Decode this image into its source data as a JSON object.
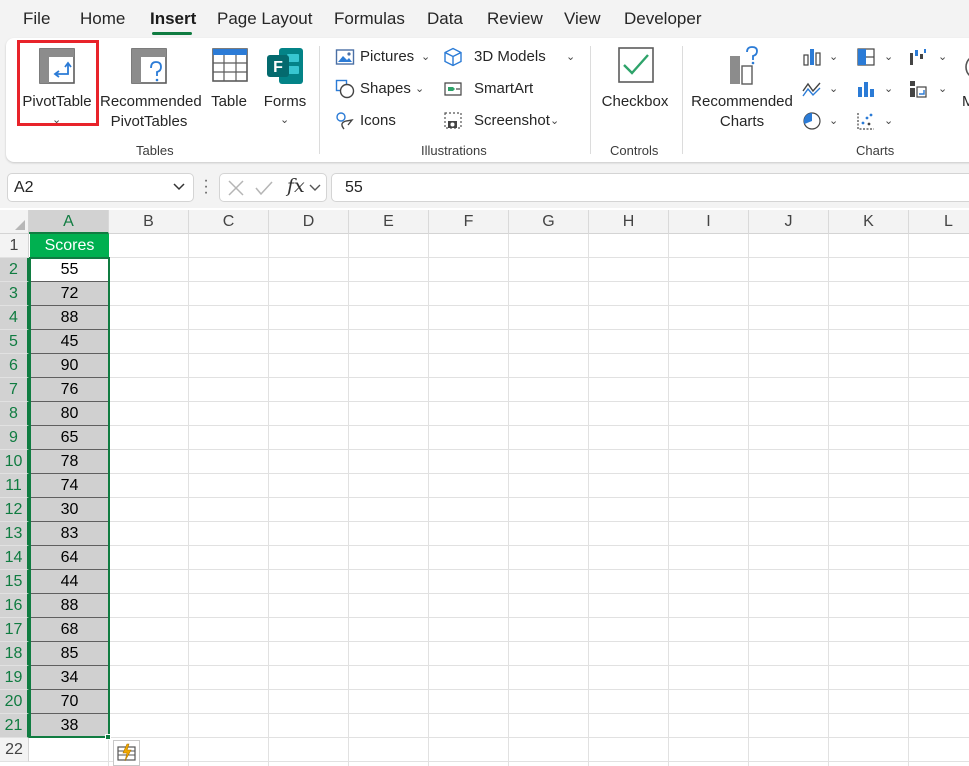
{
  "menu": {
    "tabs": [
      "File",
      "Home",
      "Insert",
      "Page Layout",
      "Formulas",
      "Data",
      "Review",
      "View",
      "Developer"
    ],
    "active_tab": "Insert"
  },
  "ribbon": {
    "tables": {
      "pivottable": "PivotTable",
      "recommended_pivottables_line1": "Recommended",
      "recommended_pivottables_line2": "PivotTables",
      "table": "Table",
      "forms": "Forms",
      "group_label": "Tables"
    },
    "illustrations": {
      "pictures": "Pictures",
      "shapes": "Shapes",
      "icons": "Icons",
      "models_3d": "3D Models",
      "smartart": "SmartArt",
      "screenshot": "Screenshot",
      "group_label": "Illustrations"
    },
    "controls": {
      "checkbox": "Checkbox",
      "group_label": "Controls"
    },
    "charts": {
      "recommended_charts_line1": "Recommended",
      "recommended_charts_line2": "Charts",
      "group_label": "Charts"
    },
    "overflow_label": "M"
  },
  "formula_bar": {
    "name_box": "A2",
    "fx_label": "fx",
    "formula_value": "55"
  },
  "sheet": {
    "columns": [
      "A",
      "B",
      "C",
      "D",
      "E",
      "F",
      "G",
      "H",
      "I",
      "J",
      "K",
      "L"
    ],
    "rows": [
      "1",
      "2",
      "3",
      "4",
      "5",
      "6",
      "7",
      "8",
      "9",
      "10",
      "11",
      "12",
      "13",
      "14",
      "15",
      "16",
      "17",
      "18",
      "19",
      "20",
      "21",
      "22"
    ],
    "header": "Scores",
    "scores": [
      "55",
      "72",
      "88",
      "45",
      "90",
      "76",
      "80",
      "65",
      "78",
      "74",
      "30",
      "83",
      "64",
      "44",
      "88",
      "68",
      "85",
      "34",
      "70",
      "38"
    ]
  },
  "colors": {
    "accent": "#107c41",
    "header_fill": "#00b050",
    "selection_fill": "#d0d0d0",
    "highlight_box": "#e8232a"
  }
}
